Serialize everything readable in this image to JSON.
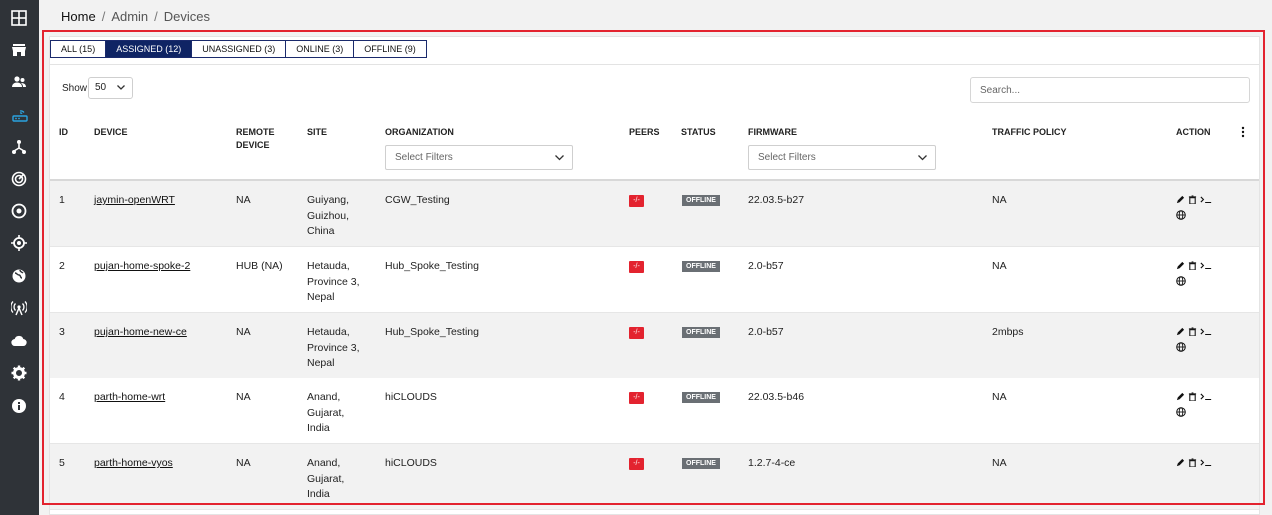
{
  "breadcrumb": {
    "home": "Home",
    "admin": "Admin",
    "current": "Devices",
    "sep": "/"
  },
  "sidebar": {
    "items": [
      "dashboard-icon",
      "store-icon",
      "users-icon",
      "router-icon",
      "network-icon",
      "radar-icon",
      "target-icon",
      "crosshair-icon",
      "globe-icon",
      "antenna-icon",
      "cloud-icon",
      "gear-icon",
      "info-icon"
    ],
    "active_index": 3
  },
  "tabs": [
    {
      "label": "ALL (15)"
    },
    {
      "label": "ASSIGNED (12)",
      "active": true
    },
    {
      "label": "UNASSIGNED (3)"
    },
    {
      "label": "ONLINE (3)"
    },
    {
      "label": "OFFLINE (9)"
    }
  ],
  "show": {
    "label": "Show",
    "value": "50"
  },
  "search": {
    "placeholder": "Search..."
  },
  "columns": {
    "id": "ID",
    "device": "DEVICE",
    "remote_device": "REMOTE DEVICE",
    "site": "SITE",
    "organization": "ORGANIZATION",
    "peers": "PEERS",
    "status": "STATUS",
    "firmware": "FIRMWARE",
    "traffic_policy": "TRAFFIC POLICY",
    "action": "ACTION"
  },
  "filters": {
    "organization_placeholder": "Select Filters",
    "firmware_placeholder": "Select Filters"
  },
  "rows": [
    {
      "id": "1",
      "device": "jaymin-openWRT",
      "remote": "NA",
      "site": "Guiyang, Guizhou, China",
      "org": "CGW_Testing",
      "peers": "-/-",
      "status": "OFFLINE",
      "firmware": "22.03.5-b27",
      "policy": "NA"
    },
    {
      "id": "2",
      "device": "pujan-home-spoke-2",
      "remote": "HUB (NA)",
      "site": "Hetauda, Province 3, Nepal",
      "org": "Hub_Spoke_Testing",
      "peers": "-/-",
      "status": "OFFLINE",
      "firmware": "2.0-b57",
      "policy": "NA"
    },
    {
      "id": "3",
      "device": "pujan-home-new-ce",
      "remote": "NA",
      "site": "Hetauda, Province 3, Nepal",
      "org": "Hub_Spoke_Testing",
      "peers": "-/-",
      "status": "OFFLINE",
      "firmware": "2.0-b57",
      "policy": "2mbps"
    },
    {
      "id": "4",
      "device": "parth-home-wrt",
      "remote": "NA",
      "site": "Anand, Gujarat, India",
      "org": "hiCLOUDS",
      "peers": "-/-",
      "status": "OFFLINE",
      "firmware": "22.03.5-b46",
      "policy": "NA"
    },
    {
      "id": "5",
      "device": "parth-home-vyos",
      "remote": "NA",
      "site": "Anand, Gujarat, India",
      "org": "hiCLOUDS",
      "peers": "-/-",
      "status": "OFFLINE",
      "firmware": "1.2.7-4-ce",
      "policy": "NA"
    }
  ],
  "colors": {
    "sidebar_bg": "#2f3338",
    "active_tab": "#0f2464",
    "peer_badge": "#e3232f",
    "status_badge": "#6a6f74",
    "highlight_frame": "#e3232f",
    "router_accent": "#2aa3e0"
  }
}
